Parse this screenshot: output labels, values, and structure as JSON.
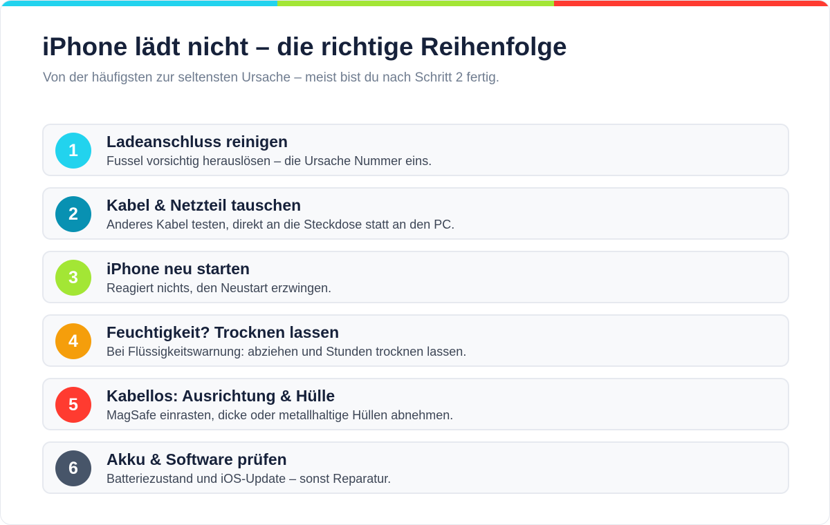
{
  "colors": {
    "bar": [
      "#22d3ee",
      "#a3e635",
      "#ff3b30"
    ],
    "title": "#16213a",
    "subtitle": "#6f7c8f"
  },
  "header": {
    "title": "iPhone lädt nicht – die richtige Reihenfolge",
    "subtitle": "Von der häufigsten zur seltensten Ursache – meist bist du nach Schritt 2 fertig."
  },
  "steps": [
    {
      "number": "1",
      "color": "#22d3ee",
      "title": "Ladeanschluss reinigen",
      "description": "Fussel vorsichtig herauslösen – die Ursache Nummer eins."
    },
    {
      "number": "2",
      "color": "#0891b2",
      "title": "Kabel & Netzteil tauschen",
      "description": "Anderes Kabel testen, direkt an die Steckdose statt an den PC."
    },
    {
      "number": "3",
      "color": "#a3e635",
      "title": "iPhone neu starten",
      "description": "Reagiert nichts, den Neustart erzwingen."
    },
    {
      "number": "4",
      "color": "#f59e0b",
      "title": "Feuchtigkeit? Trocknen lassen",
      "description": "Bei Flüssigkeitswarnung: abziehen und Stunden trocknen lassen."
    },
    {
      "number": "5",
      "color": "#ff3b30",
      "title": "Kabellos: Ausrichtung & Hülle",
      "description": "MagSafe einrasten, dicke oder metallhaltige Hüllen abnehmen."
    },
    {
      "number": "6",
      "color": "#475569",
      "title": "Akku & Software prüfen",
      "description": "Batteriezustand und iOS-Update – sonst Reparatur."
    }
  ]
}
